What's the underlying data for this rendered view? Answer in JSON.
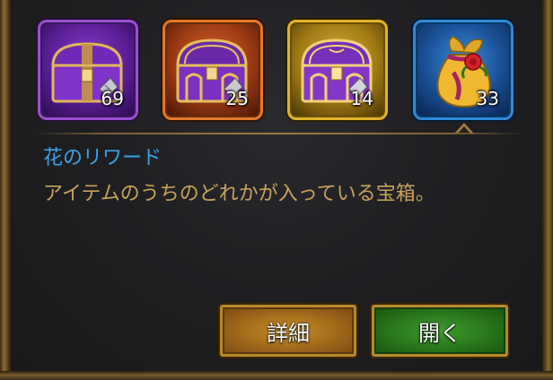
{
  "rewards": [
    {
      "id": "purple-chest",
      "count": "69",
      "frame_color": "#9a4ed0",
      "icon": "purple-treasure-chest-icon"
    },
    {
      "id": "orange-chest",
      "count": "25",
      "frame_color": "#e1782a",
      "icon": "orange-treasure-chest-icon"
    },
    {
      "id": "gold-chest",
      "count": "14",
      "frame_color": "#e0b428",
      "icon": "gold-treasure-chest-icon"
    },
    {
      "id": "flower-bag",
      "count": "33",
      "frame_color": "#2f8ad8",
      "icon": "flower-reward-bag-icon",
      "selected": true
    }
  ],
  "detail": {
    "name": "花のリワード",
    "description": "アイテムのうちのどれかが入っている宝箱。",
    "name_color": "#3aa3e8",
    "description_color": "#c9a35a"
  },
  "buttons": {
    "details_label": "詳細",
    "open_label": "開く"
  }
}
